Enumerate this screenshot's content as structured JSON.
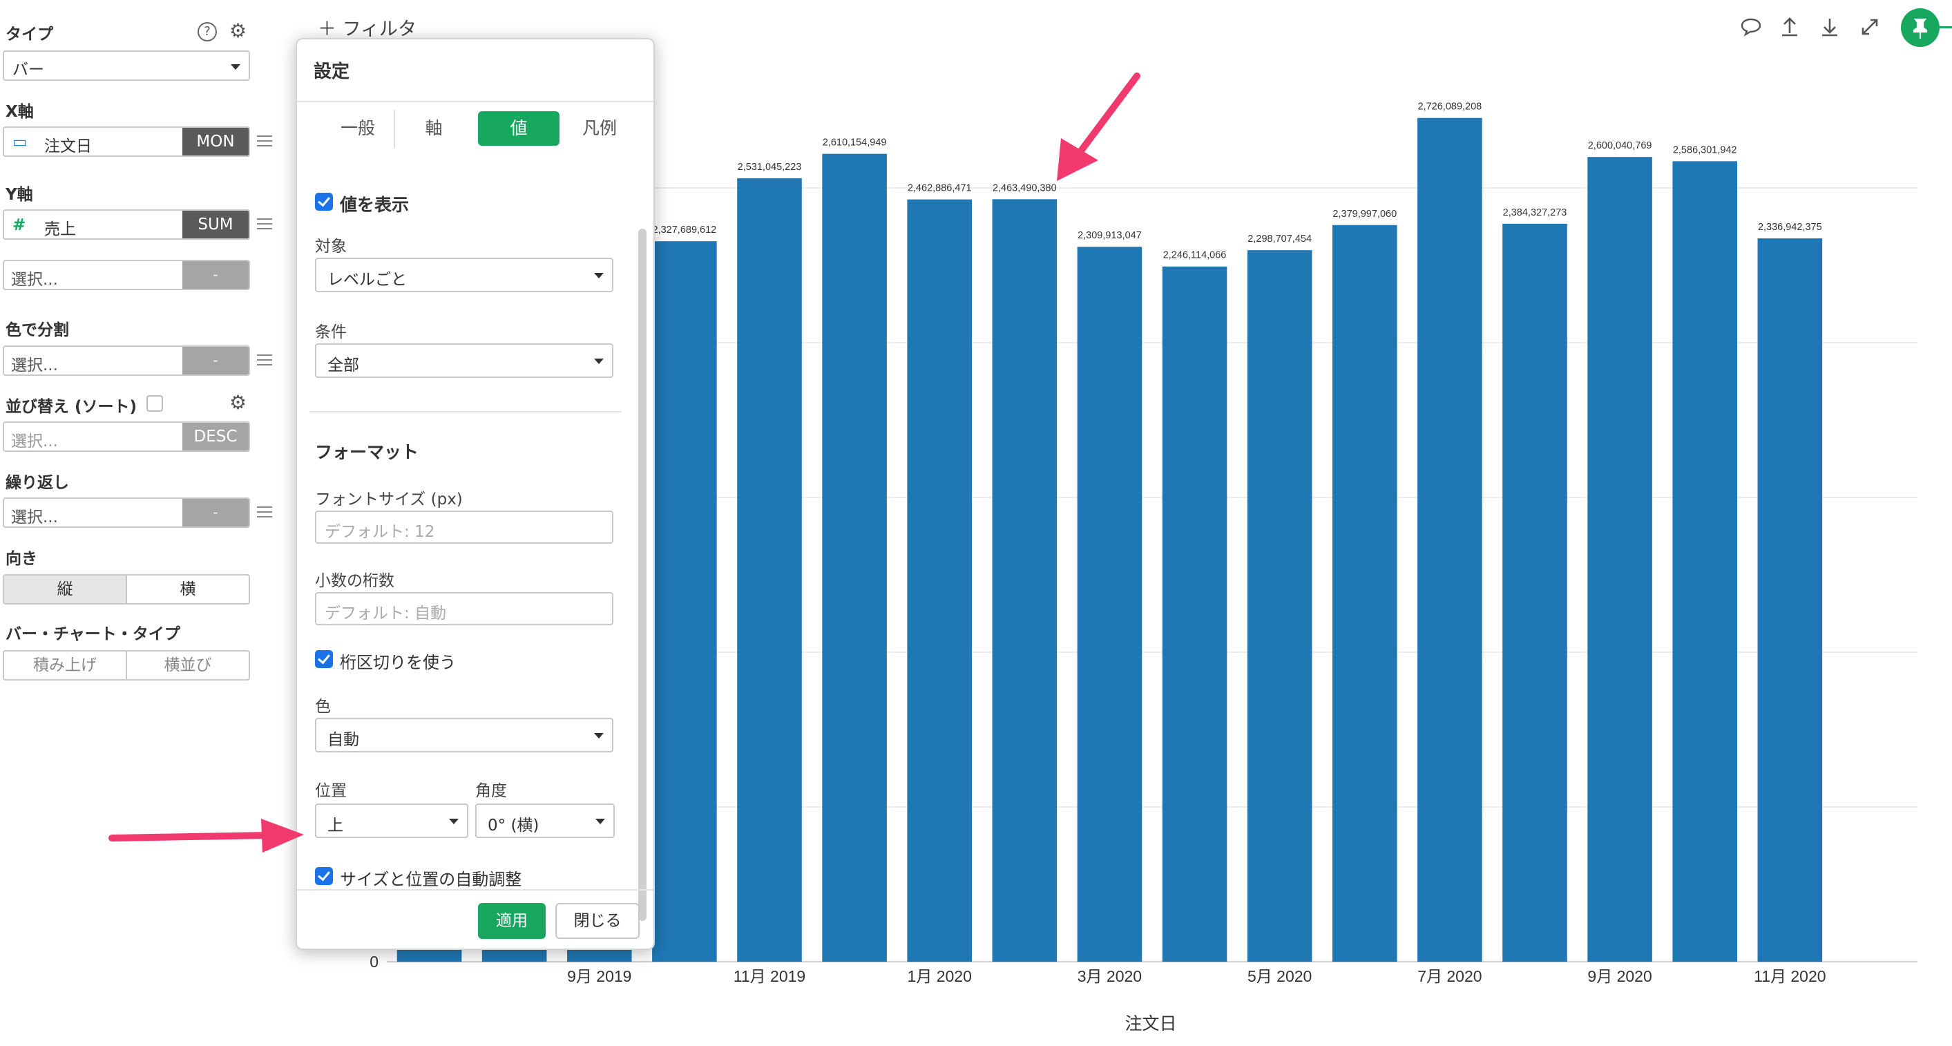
{
  "left_panel": {
    "type": {
      "label": "タイプ",
      "value": "バー"
    },
    "x_axis": {
      "label": "X軸",
      "field": "注文日",
      "agg": "MON"
    },
    "y_axis": {
      "label": "Y軸",
      "field": "売上",
      "agg": "SUM",
      "extra": "選択...",
      "extra_btn": "-"
    },
    "color_split": {
      "label": "色で分割",
      "value": "選択...",
      "btn": "-"
    },
    "sort": {
      "label": "並び替え (ソート)",
      "value": "選択...",
      "btn": "DESC"
    },
    "repeat": {
      "label": "繰り返し",
      "value": "選択...",
      "btn": "-"
    },
    "orientation": {
      "label": "向き",
      "options": [
        "縦",
        "横"
      ]
    },
    "bar_type": {
      "label": "バー・チャート・タイプ",
      "options": [
        "積み上げ",
        "横並び"
      ]
    }
  },
  "toolbar": {
    "filter_label": "フィルタ",
    "icons": [
      "comment-icon",
      "upload-icon",
      "download-icon",
      "expand-icon",
      "pin-icon"
    ]
  },
  "dialog": {
    "title": "設定",
    "tabs": [
      "一般",
      "軸",
      "値",
      "凡例"
    ],
    "active_tab": "値",
    "show_values_label": "値を表示",
    "target_label": "対象",
    "target_value": "レベルごと",
    "condition_label": "条件",
    "condition_value": "全部",
    "format_title": "フォーマット",
    "font_size_label": "フォントサイズ (px)",
    "font_size_placeholder": "デフォルト: 12",
    "decimals_label": "小数の桁数",
    "decimals_placeholder": "デフォルト: 自動",
    "thousands_label": "桁区切りを使う",
    "color_label": "色",
    "color_value": "自動",
    "position_label": "位置",
    "position_value": "上",
    "angle_label": "角度",
    "angle_value": "0° (横)",
    "auto_adjust_label": "サイズと位置の自動調整",
    "apply_label": "適用",
    "close_label": "閉じる"
  },
  "chart_data": {
    "type": "bar",
    "xlabel": "注文日",
    "ylabel": "",
    "ylim": [
      0,
      2750000000
    ],
    "zero_tick": "0",
    "bar_color": "#1f77b4",
    "categories": [
      "2019-07",
      "2019-08",
      "2019-09",
      "2019-10",
      "2019-11",
      "2019-12",
      "2020-01",
      "2020-02",
      "2020-03",
      "2020-04",
      "2020-05",
      "2020-06",
      "2020-07",
      "2020-08",
      "2020-09",
      "2020-10",
      "2020-11",
      "2020-12"
    ],
    "values": [
      null,
      null,
      null,
      2327689612,
      2531045223,
      2610154949,
      2462886471,
      2463490380,
      2309913047,
      2246114066,
      2298707454,
      2379997060,
      2726089208,
      2384327273,
      2600040769,
      2586301942,
      2336942375,
      null
    ],
    "value_labels": [
      "",
      "",
      "",
      "2,327,689,612",
      "2,531,045,223",
      "2,610,154,949",
      "2,462,886,471",
      "2,463,490,380",
      "2,309,913,047",
      "2,246,114,066",
      "2,298,707,454",
      "2,379,997,060",
      "2,726,089,208",
      "2,384,327,273",
      "2,600,040,769",
      "2,586,301,942",
      "2,336,942,375",
      ""
    ],
    "x_tick_labels": [
      "9月 2019",
      "11月 2019",
      "1月 2020",
      "3月 2020",
      "5月 2020",
      "7月 2020",
      "9月 2020",
      "11月 2020"
    ]
  },
  "annotations": {
    "arrow_color": "#f03a6e"
  }
}
